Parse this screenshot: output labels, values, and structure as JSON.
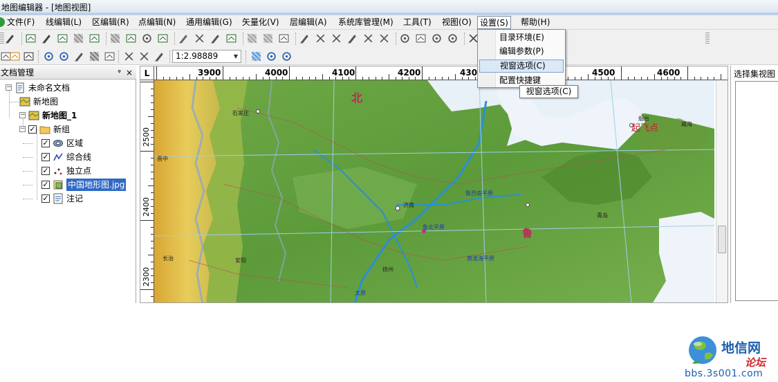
{
  "window": {
    "title": "地图编辑器 - [地图视图]"
  },
  "menubar": {
    "items": [
      {
        "label": "文件(F)"
      },
      {
        "label": "线编辑(L)"
      },
      {
        "label": "区编辑(R)"
      },
      {
        "label": "点编辑(N)"
      },
      {
        "label": "通用编辑(G)"
      },
      {
        "label": "矢量化(V)"
      },
      {
        "label": "层编辑(A)"
      },
      {
        "label": "系统库管理(M)"
      },
      {
        "label": "工具(T)"
      },
      {
        "label": "视图(O)"
      },
      {
        "label": "设置(S)"
      },
      {
        "label": "帮助(H)"
      }
    ],
    "active_index": 10
  },
  "settings_menu": {
    "items": [
      {
        "label": "目录环境(E)"
      },
      {
        "label": "编辑参数(P)"
      },
      {
        "label": "视窗选项(C)"
      },
      {
        "label": "配置快捷键"
      }
    ],
    "highlighted_index": 2,
    "tooltip": "视窗选项(C)"
  },
  "toolbar": {
    "scale_value": "1:2.98889",
    "icons_row1": [
      "pointer-tool-icon",
      "node-edit-icon",
      "line-edit-icon",
      "line-style-icon",
      "line-parameter-icon",
      "line-attribute-icon",
      "region-edit-icon",
      "region-style-icon",
      "point-edit-icon",
      "point-style-icon",
      "fill-icon",
      "filter-icon",
      "vector-icon",
      "vector-batch-icon",
      "grid-icon",
      "grid-edit-icon",
      "layer-icon",
      "pen-icon",
      "cut-icon",
      "cut-point-icon",
      "connect-icon",
      "split-icon",
      "trim-icon",
      "circle-icon",
      "attribute-icon",
      "query-icon",
      "check-icon",
      "delete-icon",
      "edit-attribute-icon",
      "parameter-icon",
      "brush-icon",
      "style-icon",
      "copy-icon"
    ],
    "icons_row2": [
      "open-icon",
      "open-folder-icon",
      "save-icon",
      "zoom-in-icon",
      "zoom-out-icon",
      "pan-hand-icon",
      "full-extent-icon",
      "previous-view-icon",
      "undo-icon",
      "redo-icon",
      "magic-wand-icon",
      "layer-manager-icon",
      "find-icon",
      "help-icon"
    ]
  },
  "document_panel": {
    "title": "文档管理",
    "pin_glyph": "ᵠ",
    "close_glyph": "×",
    "tree": [
      {
        "label": "未命名文档",
        "level": 0,
        "bold": false,
        "checked": null,
        "icon": "document-icon"
      },
      {
        "label": "新地图",
        "level": 1,
        "bold": false,
        "checked": null,
        "icon": "map-icon"
      },
      {
        "label": "新地图_1",
        "level": 1,
        "bold": true,
        "checked": null,
        "icon": "map-icon"
      },
      {
        "label": "新组",
        "level": 2,
        "bold": false,
        "checked": true,
        "icon": "folder-icon"
      },
      {
        "label": "区域",
        "level": 3,
        "bold": false,
        "checked": true,
        "icon": "region-layer-icon"
      },
      {
        "label": "综合线",
        "level": 3,
        "bold": false,
        "checked": true,
        "icon": "line-layer-icon"
      },
      {
        "label": "独立点",
        "level": 3,
        "bold": false,
        "checked": true,
        "icon": "point-layer-icon"
      },
      {
        "label": "中国地形图.jpg",
        "level": 3,
        "bold": false,
        "checked": true,
        "icon": "raster-layer-icon",
        "selected": true
      },
      {
        "label": "注记",
        "level": 3,
        "bold": false,
        "checked": true,
        "icon": "annotation-layer-icon"
      }
    ]
  },
  "map_view": {
    "corner_label": "L",
    "ruler_top_labels": [
      "3900",
      "4000",
      "4100",
      "4200",
      "430",
      "4500",
      "4600"
    ],
    "ruler_left_labels": [
      "2500",
      "2400",
      "2300"
    ],
    "map_labels": [
      {
        "text": "北"
      },
      {
        "text": "起飞点"
      },
      {
        "text": "石家庄"
      },
      {
        "text": "鲁"
      },
      {
        "text": "长治"
      },
      {
        "text": "安阳"
      },
      {
        "text": "济南"
      },
      {
        "text": "烟台"
      },
      {
        "text": "威海"
      },
      {
        "text": "青岛"
      },
      {
        "text": "徐州"
      },
      {
        "text": "鲁西南平原"
      },
      {
        "text": "鲁北平原"
      },
      {
        "text": "黄淮海平原"
      },
      {
        "text": "晋中"
      },
      {
        "text": "太原"
      }
    ]
  },
  "selection_panel": {
    "title": "选择集视图"
  },
  "watermark": {
    "title": "地信网",
    "subtitle": "论坛",
    "url": "bbs.3s001.com"
  },
  "colors": {
    "accent_blue": "#316ac5",
    "menu_highlight": "#dbe8f6",
    "map_green": "#5f9e3a",
    "map_sea": "#e8f0f8",
    "map_mountain_yellow": "#e6c24a",
    "watermark_blue": "#1a5fb0",
    "watermark_red": "#d0252f"
  }
}
